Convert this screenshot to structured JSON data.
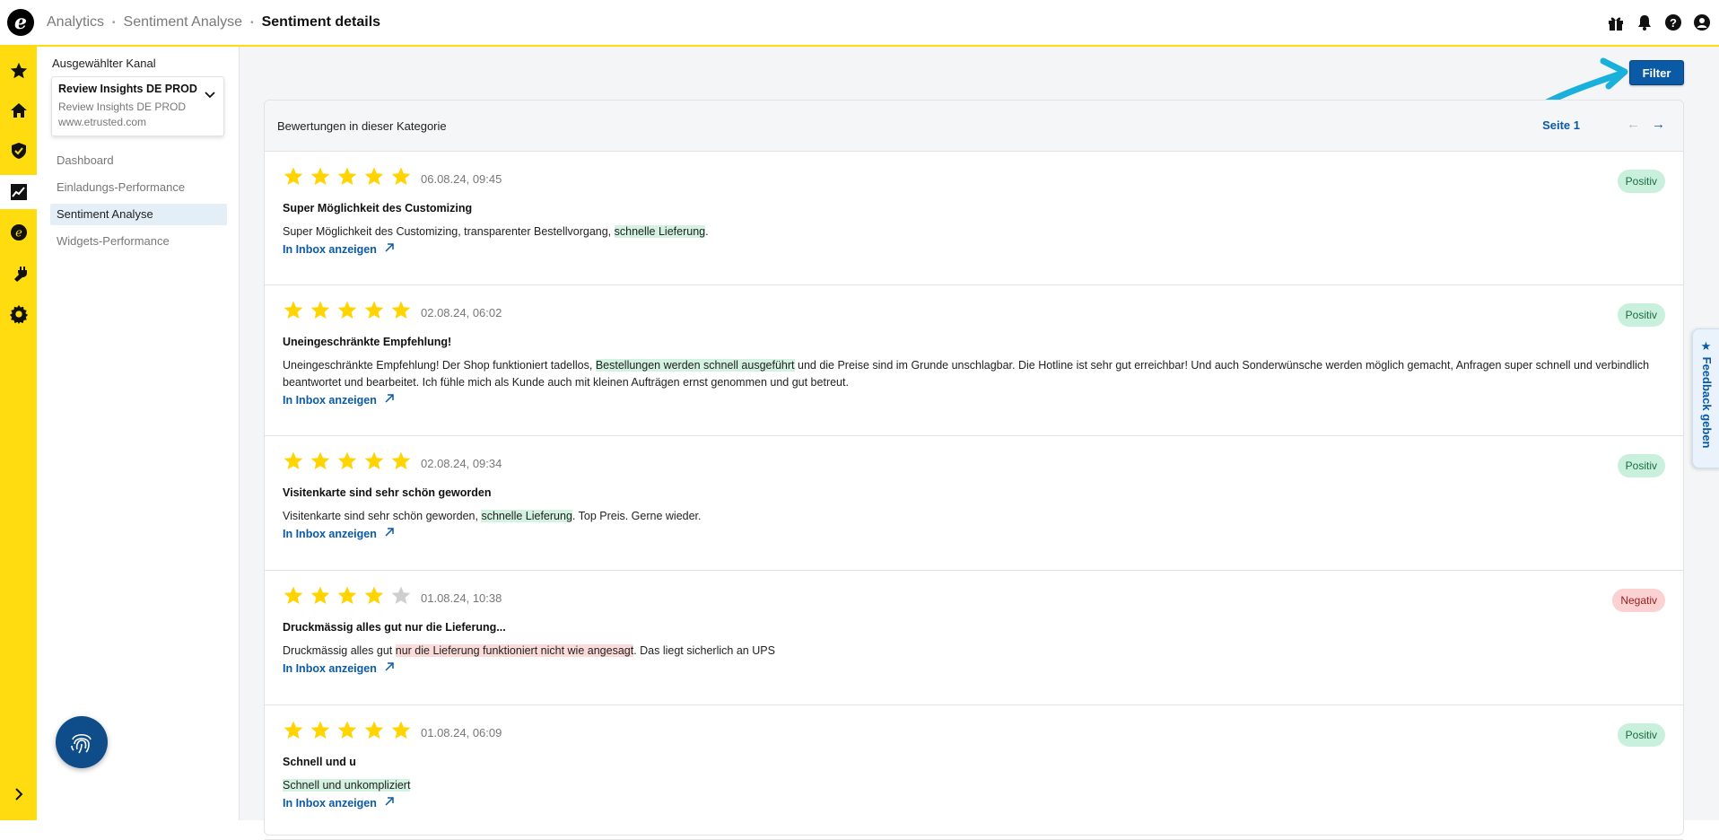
{
  "header": {
    "logo_letter": "e",
    "breadcrumb": [
      "Analytics",
      "Sentiment Analyse"
    ],
    "current": "Sentiment details",
    "icons": [
      "gift-icon",
      "bell-icon",
      "help-icon",
      "user-icon"
    ]
  },
  "rail": {
    "items": [
      "star-icon",
      "home-icon",
      "shield-check-icon",
      "chart-icon",
      "etrusted-icon",
      "plug-icon",
      "settings-icon"
    ],
    "active": "chart-icon",
    "expand_icon": "chevron-right-icon"
  },
  "sidebar": {
    "label": "Ausgewählter Kanal",
    "channel": {
      "name": "Review Insights DE PROD",
      "sub": "Review Insights DE PROD",
      "url": "www.etrusted.com"
    },
    "nav": [
      "Dashboard",
      "Einladungs-Performance",
      "Sentiment Analyse",
      "Widgets-Performance"
    ],
    "active_index": 2
  },
  "main": {
    "filter_label": "Filter",
    "panel_title": "Bewertungen in dieser Kategorie",
    "page_label": "Seite 1",
    "inbox_label": "In Inbox anzeigen",
    "feedback_label": "Feedback geben",
    "reviews": [
      {
        "rating": 5,
        "date": "06.08.24, 09:45",
        "sentiment": "Positiv",
        "title": "Super Möglichkeit des Customizing",
        "text_before": "Super Möglichkeit des Customizing, transparenter Bestellvorgang, ",
        "highlight": "schnelle Lieferung",
        "text_after": "."
      },
      {
        "rating": 5,
        "date": "02.08.24, 06:02",
        "sentiment": "Positiv",
        "title": "Uneingeschränkte Empfehlung!",
        "text_before": "Uneingeschränkte Empfehlung! Der Shop funktioniert tadellos, ",
        "highlight": "Bestellungen werden schnell ausgeführt",
        "text_after": "  und die Preise sind im Grunde unschlagbar. Die Hotline ist sehr gut erreichbar! Und auch Sonderwünsche werden möglich gemacht, Anfragen super schnell und verbindlich beantwortet und bearbeitet. Ich fühle mich als Kunde auch mit kleinen Aufträgen ernst genommen und gut betreut."
      },
      {
        "rating": 5,
        "date": "02.08.24, 09:34",
        "sentiment": "Positiv",
        "title": "Visitenkarte sind sehr schön geworden",
        "text_before": "Visitenkarte sind sehr schön geworden, ",
        "highlight": "schnelle Lieferung",
        "text_after": ". Top Preis. Gerne wieder."
      },
      {
        "rating": 4,
        "date": "01.08.24, 10:38",
        "sentiment": "Negativ",
        "title": "Druckmässig alles gut nur die Lieferung...",
        "text_before": "Druckmässig alles gut ",
        "highlight": "nur die Lieferung funktioniert nicht wie angesagt",
        "text_after": ". Das liegt sicherlich an UPS"
      },
      {
        "rating": 5,
        "date": "01.08.24, 06:09",
        "sentiment": "Positiv",
        "title": "Schnell und u",
        "text_before": "",
        "highlight": "Schnell und unkompliziert",
        "text_after": ""
      }
    ]
  },
  "colors": {
    "brand_yellow": "#ffdc0f",
    "primary_blue": "#0a5aa6",
    "star_on": "#ffd400",
    "star_off": "#cfcfcf",
    "annotation_arrow": "#1ab0dc"
  }
}
